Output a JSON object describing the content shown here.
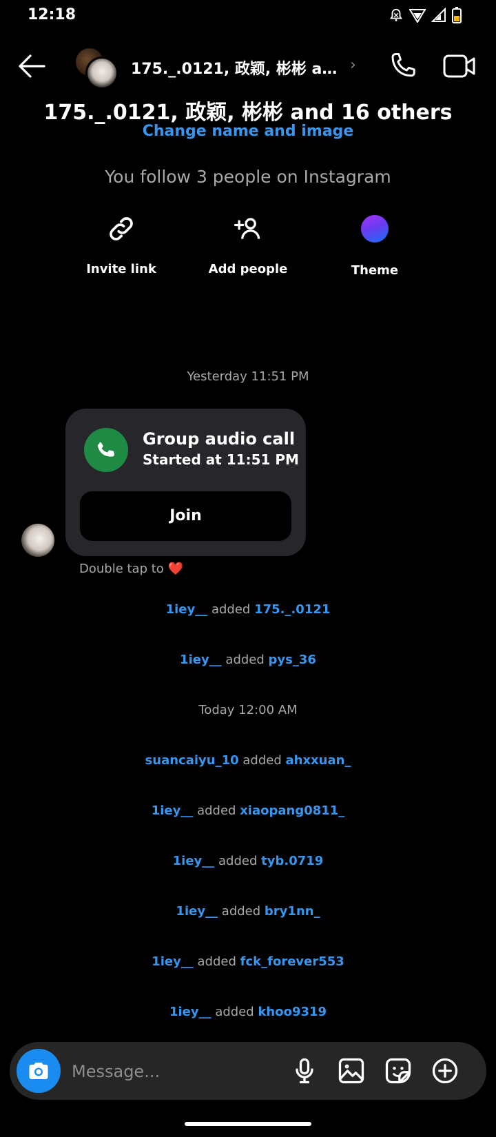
{
  "status": {
    "time": "12:18"
  },
  "header": {
    "title": "175._.0121, 政颖, 彬彬 and 16 others"
  },
  "info": {
    "group_name": "175._.0121, 政颖, 彬彬 and 16 others",
    "change_link": "Change name and image",
    "follow_text": "You follow 3 people on Instagram"
  },
  "actions": {
    "invite": "Invite link",
    "add": "Add people",
    "theme": "Theme"
  },
  "timestamps": {
    "yesterday": "Yesterday 11:51 PM",
    "today": "Today 12:00 AM"
  },
  "call": {
    "title": "Group audio call",
    "subtitle": "Started at 11:51 PM",
    "join": "Join"
  },
  "double_tap": "Double tap to ❤️",
  "events": [
    {
      "actor": "1iey__",
      "verb": "added",
      "target": "175._.0121"
    },
    {
      "actor": "1iey__",
      "verb": "added",
      "target": "pys_36"
    },
    {
      "actor": "suancaiyu_10",
      "verb": "added",
      "target": "ahxxuan_"
    },
    {
      "actor": "1iey__",
      "verb": "added",
      "target": "xiaopang0811_"
    },
    {
      "actor": "1iey__",
      "verb": "added",
      "target": "tyb.0719"
    },
    {
      "actor": "1iey__",
      "verb": "added",
      "target": "bry1nn_"
    },
    {
      "actor": "1iey__",
      "verb": "added",
      "target": "fck_forever553"
    },
    {
      "actor": "1iey__",
      "verb": "added",
      "target": "khoo9319"
    }
  ],
  "composer": {
    "placeholder": "Message..."
  },
  "colors": {
    "link": "#3797f0",
    "call_green": "#1f8a44",
    "camera_blue": "#1a8cf0"
  }
}
